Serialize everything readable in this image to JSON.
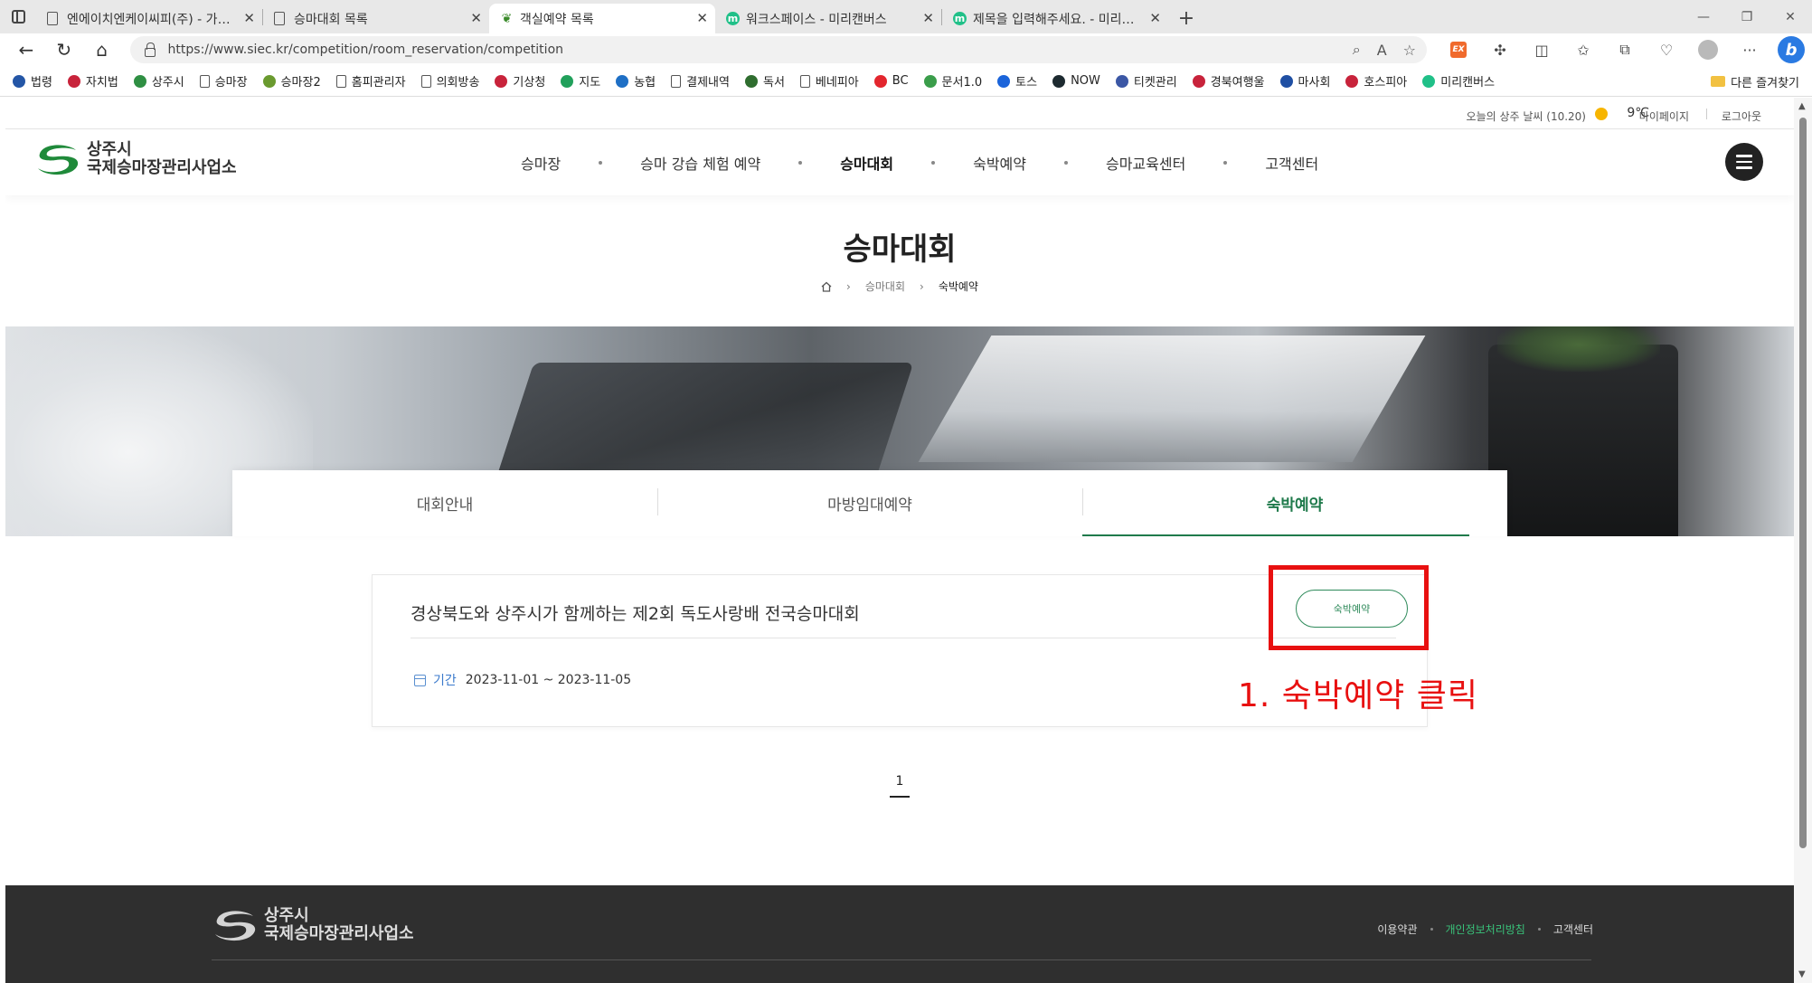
{
  "browser": {
    "tabs": [
      {
        "label": "엔에이치엔케이씨피(주) - 가명정",
        "icon": "doc",
        "active": false
      },
      {
        "label": "승마대회 목록",
        "icon": "doc",
        "active": false
      },
      {
        "label": "객실예약 목록",
        "icon": "leaf",
        "active": true
      },
      {
        "label": "워크스페이스 - 미리캔버스",
        "icon": "m",
        "active": false
      },
      {
        "label": "제목을 입력해주세요. - 미리캔버",
        "icon": "m",
        "active": false
      }
    ],
    "url": "https://www.siec.kr/competition/room_reservation/competition",
    "bookmarks": [
      {
        "label": "법령",
        "color": "#2456a6"
      },
      {
        "label": "자치법",
        "color": "#c8233b"
      },
      {
        "label": "상주시",
        "color": "#2f8f43"
      },
      {
        "label": "승마장",
        "color": "doc"
      },
      {
        "label": "승마장2",
        "color": "#6a9a2f"
      },
      {
        "label": "홈피관리자",
        "color": "doc"
      },
      {
        "label": "의회방송",
        "color": "doc"
      },
      {
        "label": "기상청",
        "color": "#c8233b"
      },
      {
        "label": "지도",
        "color": "#21a05b"
      },
      {
        "label": "농협",
        "color": "#1e6fc5"
      },
      {
        "label": "결제내역",
        "color": "doc"
      },
      {
        "label": "독서",
        "color": "#2f6d2f"
      },
      {
        "label": "베네피아",
        "color": "doc"
      },
      {
        "label": "BC",
        "color": "#e3262e"
      },
      {
        "label": "문서1.0",
        "color": "#3a9d4a"
      },
      {
        "label": "토스",
        "color": "#1b64da"
      },
      {
        "label": "NOW",
        "color": "#1d2a30"
      },
      {
        "label": "티켓관리",
        "color": "#3b57a5"
      },
      {
        "label": "경북여행울",
        "color": "#c8233b"
      },
      {
        "label": "마사회",
        "color": "#1f4fa3"
      },
      {
        "label": "호스피아",
        "color": "#c8233b"
      },
      {
        "label": "미리캔버스",
        "color": "#20c088"
      }
    ],
    "other_bookmarks": "다른 즐겨찾기"
  },
  "topbar": {
    "weather": "오늘의 상주 날씨 (10.20)",
    "temperature": "9℃",
    "mypage": "마이페이지",
    "logout": "로그아웃"
  },
  "header": {
    "logo_line1": "상주시",
    "logo_line2": "국제승마장관리사업소",
    "nav": [
      {
        "label": "승마장",
        "active": false
      },
      {
        "label": "승마 강습 체험 예약",
        "active": false
      },
      {
        "label": "승마대회",
        "active": true
      },
      {
        "label": "숙박예약",
        "active": false
      },
      {
        "label": "승마교육센터",
        "active": false
      },
      {
        "label": "고객센터",
        "active": false
      }
    ]
  },
  "page": {
    "title": "승마대회",
    "breadcrumb": [
      "승마대회",
      "숙박예약"
    ]
  },
  "subtabs": [
    {
      "label": "대회안내",
      "active": false
    },
    {
      "label": "마방임대예약",
      "active": false
    },
    {
      "label": "숙박예약",
      "active": true
    }
  ],
  "card": {
    "title": "경상북도와 상주시가 함께하는 제2회 독도사랑배 전국승마대회",
    "period_label": "기간",
    "period": "2023-11-01 ~ 2023-11-05",
    "button": "숙박예약"
  },
  "annotation": "1. 숙박예약 클릭",
  "pagination": [
    "1"
  ],
  "footer": {
    "logo_line1": "상주시",
    "logo_line2": "국제승마장관리사업소",
    "links": [
      {
        "label": "이용약관",
        "highlight": false
      },
      {
        "label": "개인정보처리방침",
        "highlight": true
      },
      {
        "label": "고객센터",
        "highlight": false
      }
    ]
  },
  "colors": {
    "brand_green": "#1f7a4b",
    "annotation_red": "#e81010",
    "footer_bg": "#2f2f2f"
  }
}
